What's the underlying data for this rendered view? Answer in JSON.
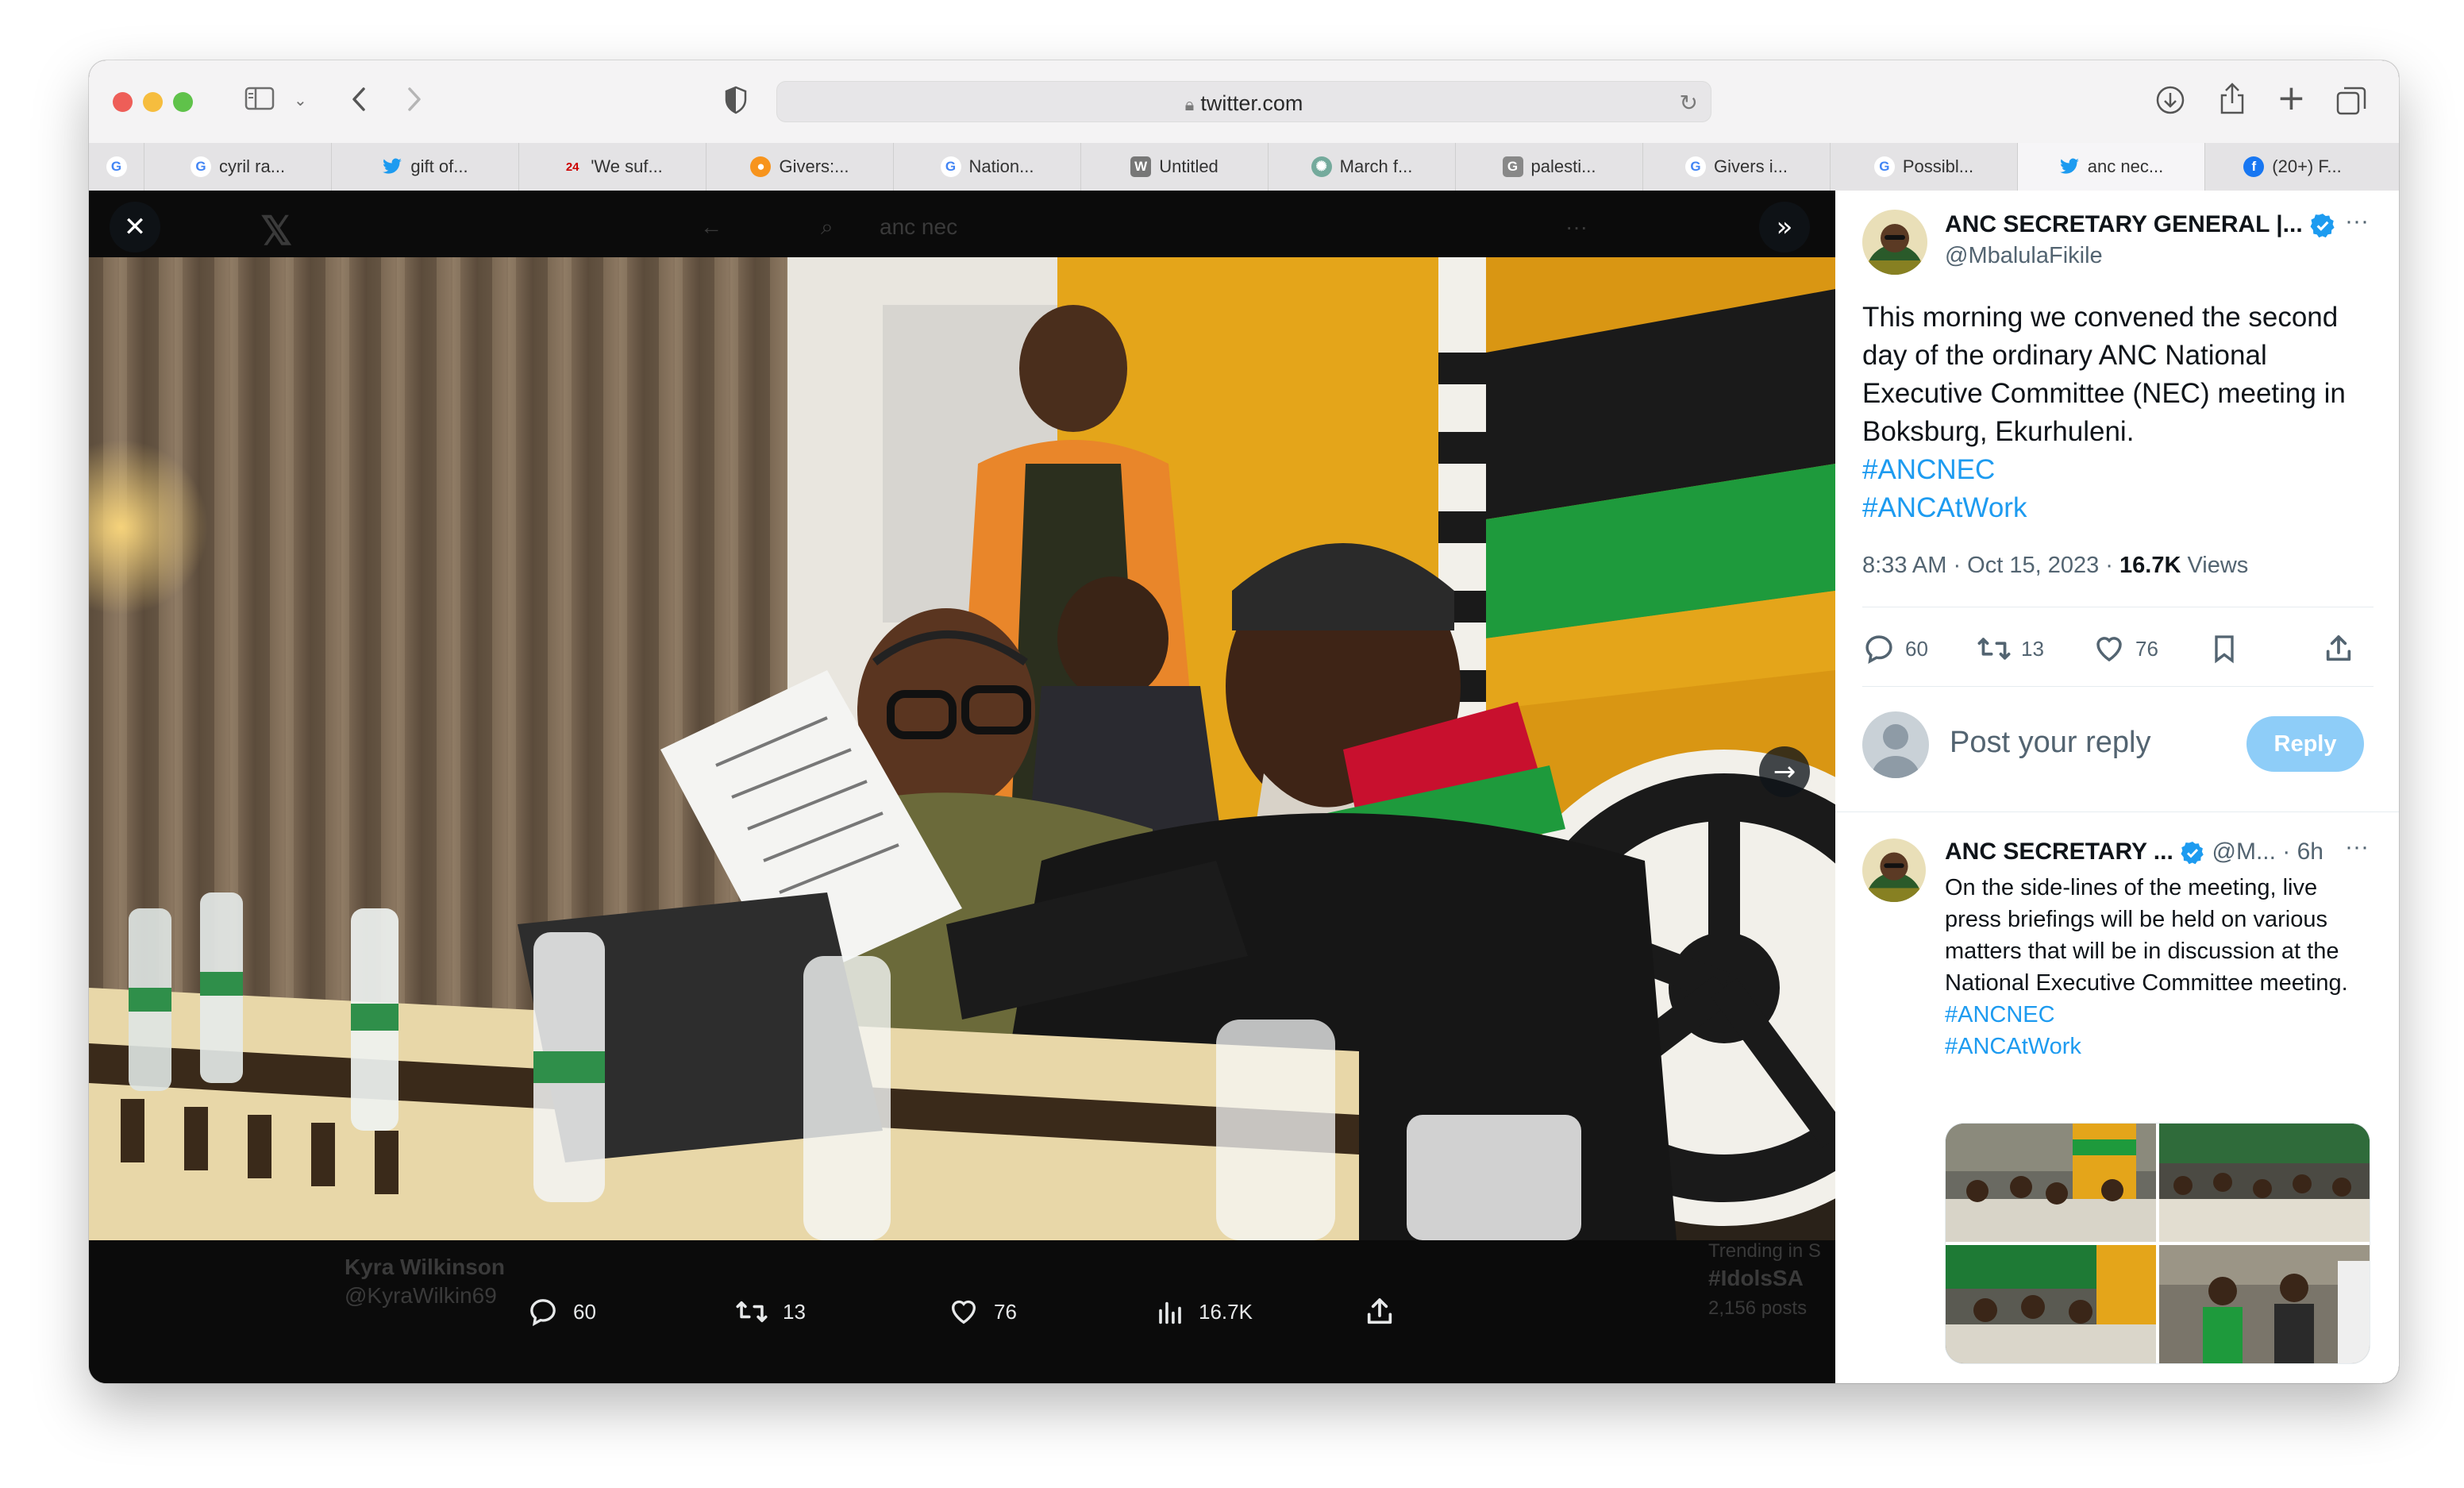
{
  "browser": {
    "url": "twitter.com",
    "tabs": [
      {
        "icon": "google-icon",
        "label": ""
      },
      {
        "icon": "google-icon",
        "label": "cyril ra..."
      },
      {
        "icon": "twitter-bird-icon",
        "label": "gift of..."
      },
      {
        "icon": "news24-icon",
        "label": "'We suf..."
      },
      {
        "icon": "givers-icon",
        "label": "Givers:..."
      },
      {
        "icon": "google-icon",
        "label": "Nation..."
      },
      {
        "icon": "wikipedia-icon",
        "label": "Untitled"
      },
      {
        "icon": "chatgpt-icon",
        "label": "March f..."
      },
      {
        "icon": "google-docs-icon",
        "label": "palesti..."
      },
      {
        "icon": "google-icon",
        "label": "Givers i..."
      },
      {
        "icon": "google-icon",
        "label": "Possibl..."
      },
      {
        "icon": "twitter-bird-icon",
        "label": "anc nec...",
        "active": true
      },
      {
        "icon": "facebook-icon",
        "label": "(20+) F..."
      }
    ]
  },
  "background_page": {
    "search_text": "anc nec",
    "reply_author": "Kyra Wilkinson",
    "reply_handle": "@KyraWilkin69",
    "trending_label": "Trending in S",
    "trending_tag": "#IdolsSA",
    "trending_count": "2,156 posts"
  },
  "media_actions": {
    "replies": "60",
    "reposts": "13",
    "likes": "76",
    "views": "16.7K"
  },
  "tweet": {
    "author": "ANC SECRETARY GENERAL |...",
    "handle": "@MbalulaFikile",
    "text": "This morning we convened the second day of the ordinary ANC National Executive Committee (NEC) meeting in Boksburg, Ekurhuleni.",
    "hashtags": [
      "#ANCNEC",
      "#ANCAtWork"
    ],
    "time": "8:33 AM · Oct 15, 2023 · ",
    "views_count": "16.7K",
    "views_label": " Views",
    "replies": "60",
    "reposts": "13",
    "likes": "76",
    "reply_placeholder": "Post your reply",
    "reply_button": "Reply"
  },
  "reply_tweet": {
    "author": "ANC SECRETARY ...",
    "handle": "@M...",
    "age": "· 6h",
    "text": "On the side-lines of the meeting, live press briefings will be held on various matters that will be in discussion at the National Executive Committee meeting.",
    "hashtags": [
      "#ANCNEC",
      "#ANCAtWork"
    ]
  },
  "colors": {
    "twitter_blue": "#1d9bf0",
    "reply_button_disabled": "#8ecdf8",
    "anc_green": "#1e9a3c",
    "anc_gold": "#e4a51a"
  }
}
